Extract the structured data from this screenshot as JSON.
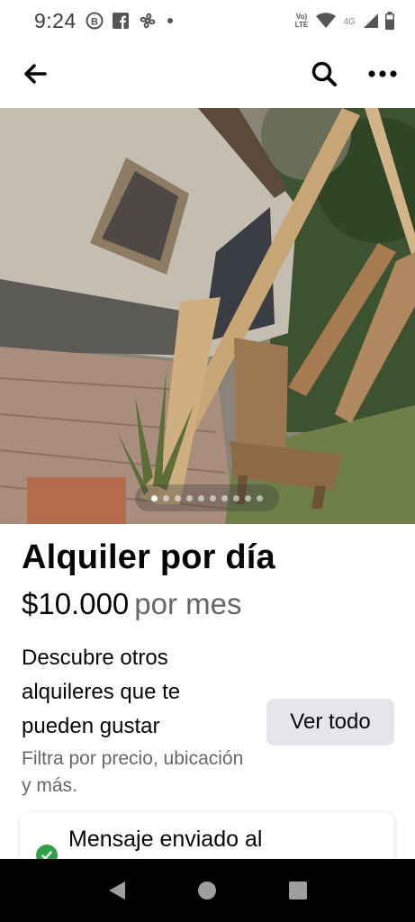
{
  "status_bar": {
    "time": "9:24",
    "left_icons": [
      "b-circle-icon",
      "facebook-icon",
      "fan-icon",
      "dot-icon"
    ],
    "right_icons": [
      "volte-icon",
      "wifi-icon",
      "4g-icon",
      "signal-icon",
      "battery-icon"
    ],
    "volte_text": "Vo) LTE",
    "network_text": "4G"
  },
  "app_bar": {
    "back_icon": "arrow-left-icon",
    "search_icon": "search-icon",
    "more_icon": "more-horizontal-icon"
  },
  "gallery": {
    "total_photos": 10,
    "active_index": 0
  },
  "listing": {
    "title": "Alquiler por día",
    "price": "$10.000",
    "price_period": "por mes"
  },
  "discover": {
    "heading": "Descubre otros alquileres que te pueden gustar",
    "subtext": "Filtra por precio, ubicación y más.",
    "button_label": "Ver todo"
  },
  "notification_card": {
    "text": "Mensaje enviado al",
    "icon": "check-circle-icon",
    "accent_color": "#31a24c"
  },
  "nav_bar": {
    "icons": [
      "back-triangle-icon",
      "home-circle-icon",
      "recents-square-icon"
    ]
  },
  "colors": {
    "text_primary": "#050505",
    "text_secondary": "#65676b",
    "button_bg": "#e4e6eb"
  }
}
